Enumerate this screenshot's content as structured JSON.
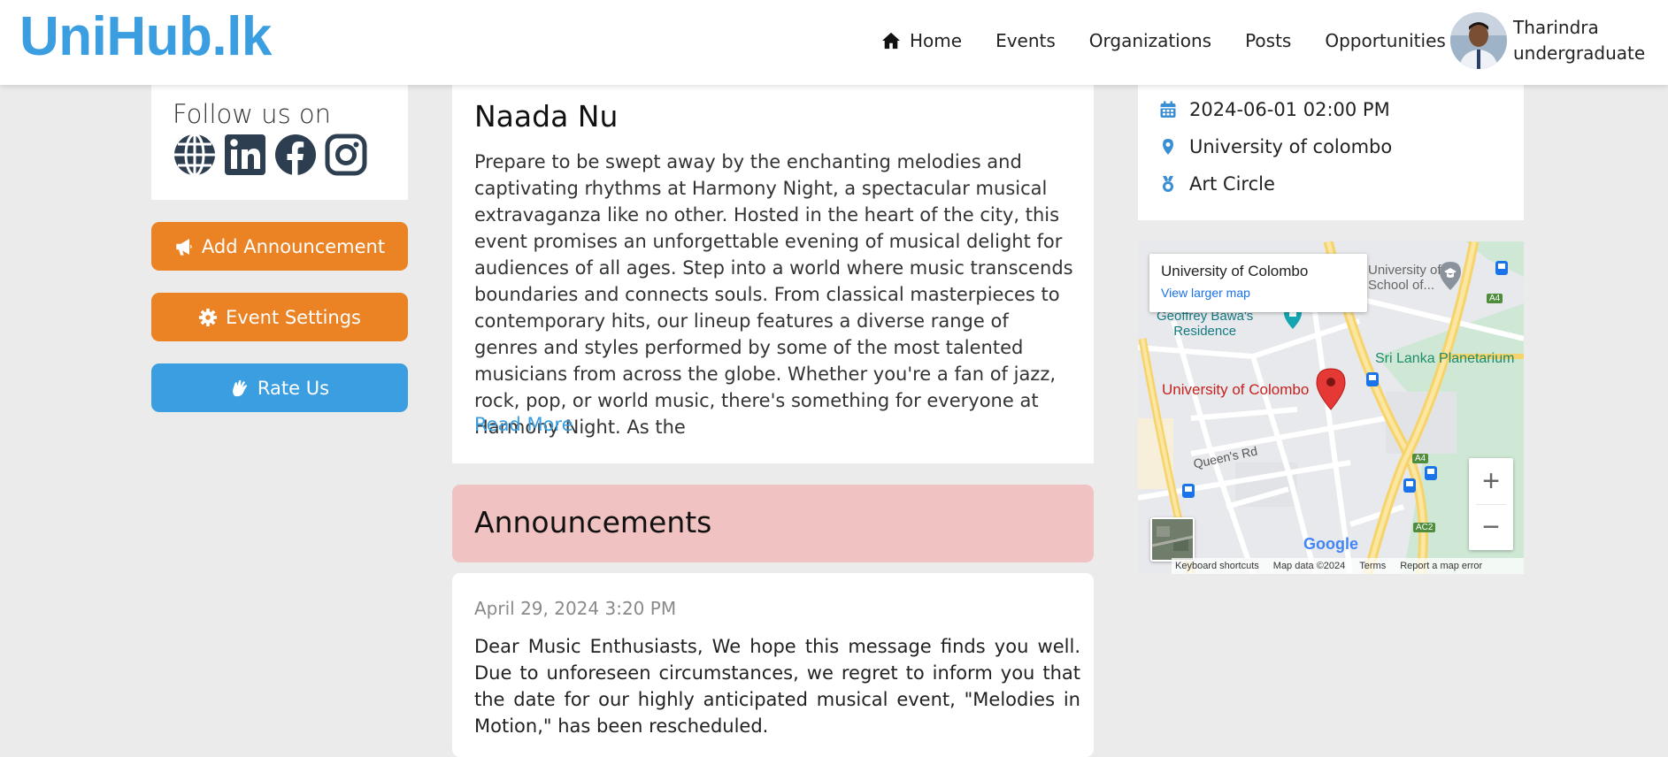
{
  "header": {
    "logo": "UniHub.lk",
    "nav": [
      {
        "label": "Home",
        "icon": "home-icon"
      },
      {
        "label": "Events"
      },
      {
        "label": "Organizations"
      },
      {
        "label": "Posts"
      },
      {
        "label": "Opportunities"
      }
    ],
    "user": {
      "name": "Tharindra",
      "role": "undergraduate"
    }
  },
  "sidebar": {
    "follow_title": "Follow us on",
    "social_icons": [
      "globe-icon",
      "linkedin-icon",
      "facebook-icon",
      "instagram-icon"
    ],
    "buttons": {
      "add_announcement": "Add Announcement",
      "event_settings": "Event Settings",
      "rate_us": "Rate Us"
    }
  },
  "event": {
    "title": "Naada Nu",
    "description": "Prepare to be swept away by the enchanting melodies and captivating rhythms at Harmony Night, a spectacular musical extravaganza like no other. Hosted in the heart of the city, this event promises an unforgettable evening of musical delight for audiences of all ages. Step into a world where music transcends boundaries and connects souls. From classical masterpieces to contemporary hits, our lineup features a diverse range of genres and styles performed by some of the most talented musicians from across the globe. Whether you're a fan of jazz, rock, pop, or world music, there's something for everyone at Harmony Night. As the",
    "read_more": "Read More",
    "datetime": "2024-06-01 02:00 PM",
    "location": "University of colombo",
    "organizer": "Art Circle"
  },
  "announcements": {
    "title": "Announcements",
    "items": [
      {
        "date": "April 29, 2024 3:20 PM",
        "body": "Dear Music Enthusiasts, We hope this message finds you well. Due to unforeseen circumstances, we regret to inform you that the date for our highly anticipated musical event, \"Melodies in Motion,\" has been rescheduled."
      }
    ]
  },
  "map": {
    "card_title": "University of Colombo",
    "card_link": "View larger map",
    "labels": {
      "pin_label": "University of Colombo",
      "planetarium": "Sri Lanka Planetarium",
      "bawa_line1": "Geoffrey Bawa's",
      "bawa_line2": "Residence",
      "school_line1": "University of",
      "school_line2": "School of...",
      "road": "Queen's Rd",
      "a4_top": "A4",
      "a4_bottom": "A4",
      "ac2": "AC2",
      "google": "Google"
    },
    "zoom_in": "+",
    "zoom_out": "−",
    "footer": [
      "Keyboard shortcuts",
      "Map data ©2024",
      "Terms",
      "Report a map error"
    ]
  },
  "colors": {
    "brand_blue": "#3a9ee0",
    "orange": "#eb8324",
    "announcement_header": "#f0c2c2",
    "map_pin": "#e53935"
  }
}
